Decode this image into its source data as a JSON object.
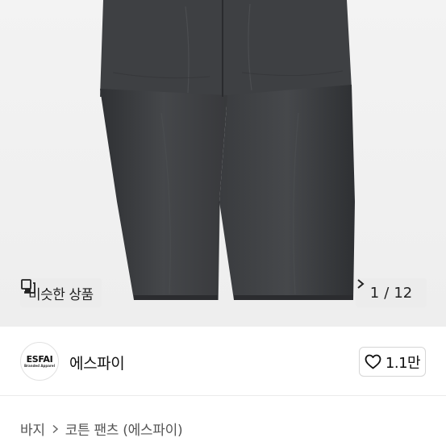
{
  "gallery": {
    "similar_label": "비슷한 상품",
    "counter_current": "1",
    "counter_separator": "/",
    "counter_total": "12",
    "background": "#f0f0f0",
    "product_color": "#3b3d40"
  },
  "seller": {
    "avatar_main": "ESFAI",
    "avatar_sub": "Branded Apparel",
    "name": "에스파이",
    "like_count": "1.1만"
  },
  "breadcrumb": {
    "category": "바지",
    "subcategory": "코튼 팬츠 (에스파이)"
  },
  "icons": {
    "similar": "copy-icon",
    "next": "chevron-right-icon",
    "like": "heart-icon"
  }
}
